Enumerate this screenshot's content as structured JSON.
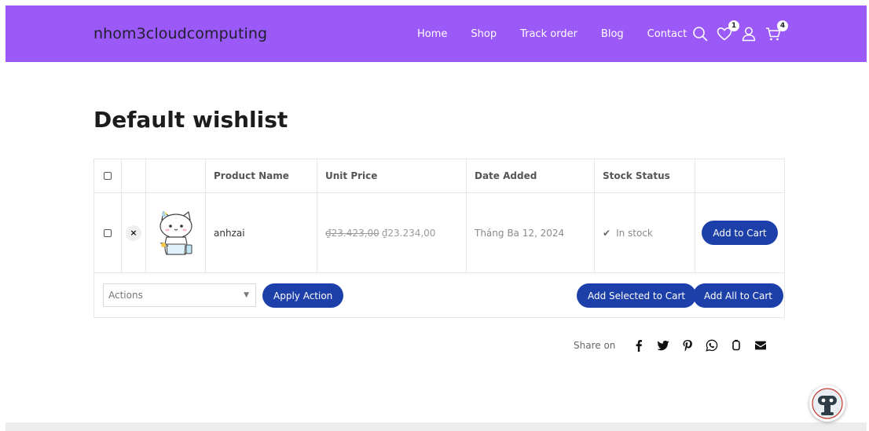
{
  "header": {
    "brand": "nhom3cloudcomputing",
    "nav": [
      "Home",
      "Shop",
      "Track order",
      "Blog",
      "Contact"
    ],
    "wishlist_count": "1",
    "cart_count": "4",
    "brand_color": "#9b59f7"
  },
  "page": {
    "title": "Default wishlist"
  },
  "table": {
    "headers": [
      "Product Name",
      "Unit Price",
      "Date Added",
      "Stock Status"
    ],
    "rows": [
      {
        "remove_glyph": "×",
        "product_name": "anhzai",
        "old_price": "₫23.423,00",
        "new_price": "₫23.234,00",
        "date_added": "Tháng Ba 12, 2024",
        "stock_status": "In stock",
        "add_to_cart": "Add to Cart"
      }
    ]
  },
  "actions": {
    "select_value": "Actions",
    "apply_label": "Apply Action",
    "add_selected_label": "Add Selected to Cart",
    "add_all_label": "Add All to Cart"
  },
  "share": {
    "label": "Share on",
    "icons": [
      "facebook-icon",
      "twitter-icon",
      "pinterest-icon",
      "whatsapp-icon",
      "copy-icon",
      "email-icon"
    ]
  },
  "colors": {
    "button": "#1c3faa"
  }
}
